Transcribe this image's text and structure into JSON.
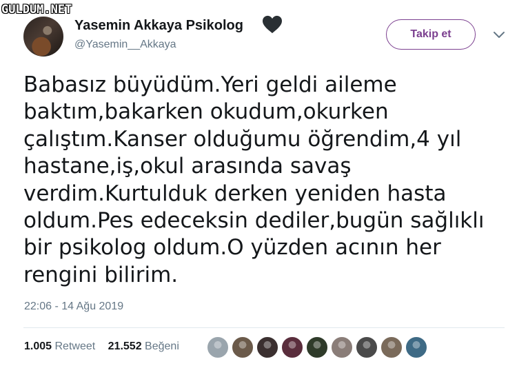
{
  "watermark": "GULDUM.NET",
  "user": {
    "display_name": "Yasemin Akkaya Psikolog",
    "handle": "@Yasemin__Akkaya",
    "avatar_icon": "avatar-photo",
    "name_emoji": "black-heart-icon"
  },
  "follow_button": {
    "label": "Takip et",
    "color": "#7b3f8f"
  },
  "menu_icon": "chevron-down-icon",
  "tweet": {
    "text": "Babasız büyüdüm.Yeri geldi aileme\nbaktım,bakarken okudum,okurken\nçalıştım.Kanser olduğumu öğrendim,4 yıl\nhastane,iş,okul arasında savaş\nverdim.Kurtulduk derken yeniden hasta\noldum.Pes edeceksin dediler,bugün sağlıklı\nbir psikolog oldum.O yüzden acının her\nrengini bilirim.",
    "timestamp": "22:06 - 14 Ağu 2019"
  },
  "stats": {
    "retweets": "1.005",
    "retweets_label": "Retweet",
    "likes": "21.552",
    "likes_label": "Beğeni"
  },
  "likers": [
    {
      "name": "liker-avatar-1",
      "color": "#9aa5ad"
    },
    {
      "name": "liker-avatar-2",
      "color": "#6b5a4a"
    },
    {
      "name": "liker-avatar-3",
      "color": "#3b3030"
    },
    {
      "name": "liker-avatar-4",
      "color": "#5a2d3c"
    },
    {
      "name": "liker-avatar-5",
      "color": "#2f3b2a"
    },
    {
      "name": "liker-avatar-6",
      "color": "#8a7d78"
    },
    {
      "name": "liker-avatar-7",
      "color": "#4a4a4a"
    },
    {
      "name": "liker-avatar-8",
      "color": "#7a6a5a"
    },
    {
      "name": "liker-avatar-9",
      "color": "#3e6a85"
    }
  ]
}
